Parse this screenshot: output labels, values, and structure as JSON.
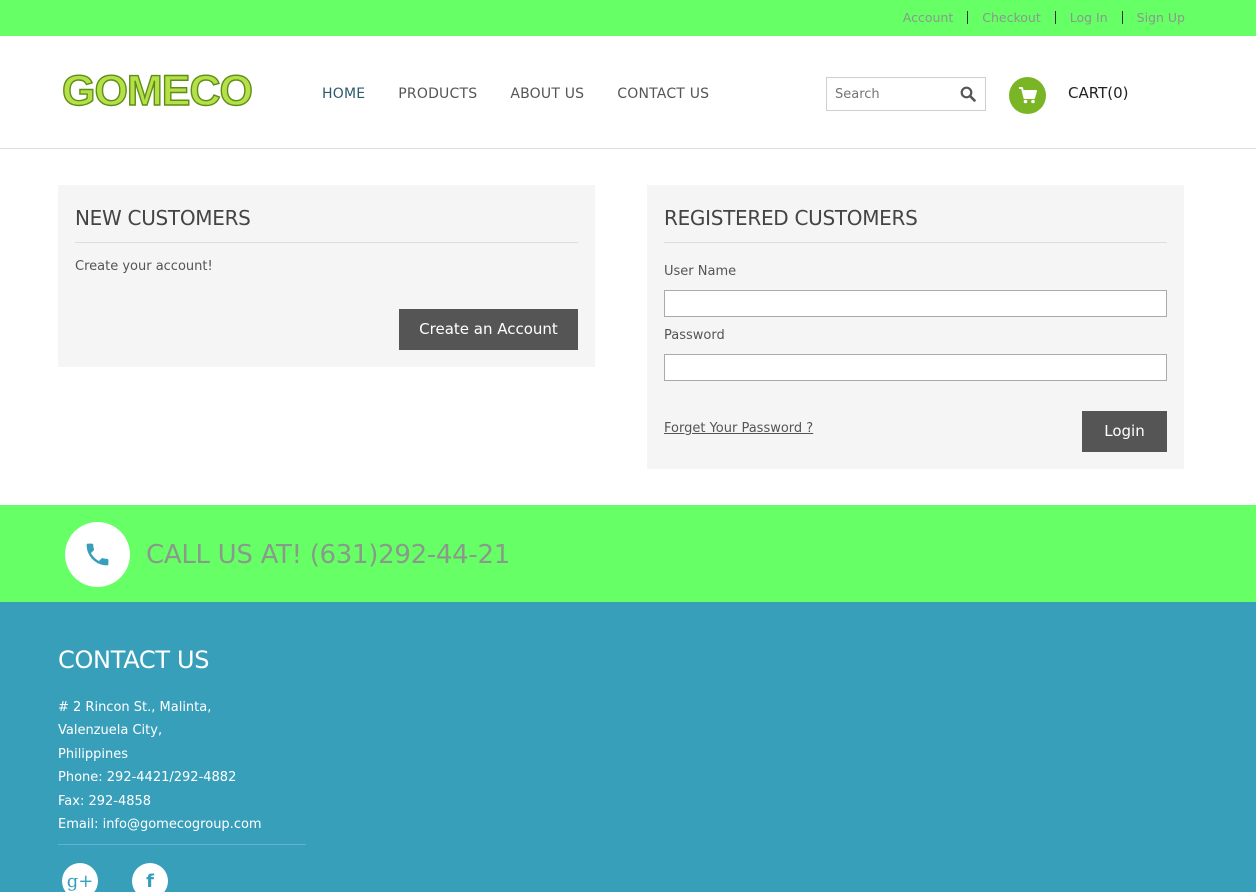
{
  "topbar": {
    "links": [
      "Account",
      "Checkout",
      "Log In",
      "Sign Up"
    ]
  },
  "header": {
    "logo_text": "GOMECO",
    "nav": [
      "HOME",
      "PRODUCTS",
      "ABOUT US",
      "CONTACT US"
    ],
    "active_nav": "HOME",
    "search_placeholder": "Search",
    "cart_label": "CART(0)"
  },
  "new_customers": {
    "title": "NEW CUSTOMERS",
    "text": "Create your account!",
    "button": "Create an Account"
  },
  "registered_customers": {
    "title": "REGISTERED CUSTOMERS",
    "username_label": "User Name",
    "username_value": "",
    "password_label": "Password",
    "password_value": "",
    "forgot_link": "Forget Your Password ?",
    "login_button": "Login"
  },
  "callband": {
    "text": "CALL US AT! (631)292-44-21"
  },
  "footer": {
    "title": "CONTACT US",
    "address_lines": [
      "# 2 Rincon St., Malinta,",
      "Valenzuela City,",
      "Philippines",
      "Phone: 292-4421/292-4882",
      "Fax: 292-4858",
      "Email: info@gomecogroup.com"
    ],
    "social": [
      "g+",
      "f"
    ]
  },
  "colors": {
    "accent_green": "#66ff66",
    "logo_green": "#7ab526",
    "footer_blue": "#389fba",
    "button_dark": "#555555"
  },
  "icons": [
    "search-icon",
    "cart-icon",
    "phone-icon",
    "google-plus-icon",
    "facebook-icon"
  ]
}
